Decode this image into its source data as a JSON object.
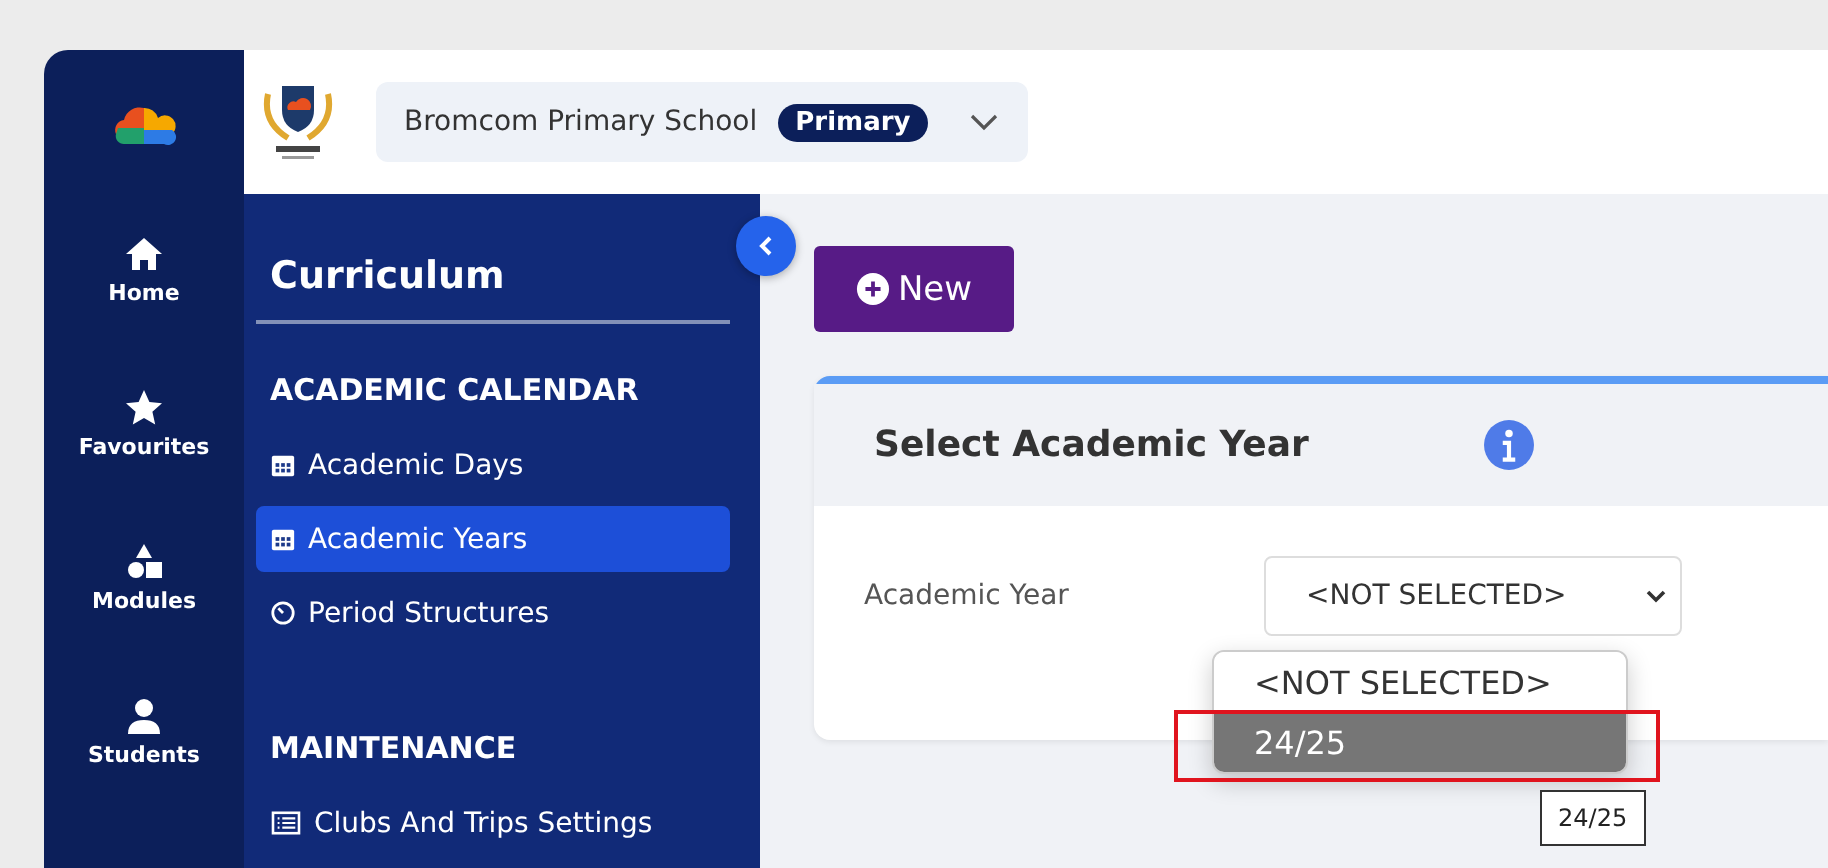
{
  "school_selector": {
    "name": "Bromcom Primary School",
    "badge": "Primary"
  },
  "rail": [
    {
      "kind": "home",
      "label": "Home"
    },
    {
      "kind": "star",
      "label": "Favourites"
    },
    {
      "kind": "shapes",
      "label": "Modules"
    },
    {
      "kind": "person",
      "label": "Students"
    }
  ],
  "side_panel": {
    "title": "Curriculum",
    "sections": [
      {
        "heading": "ACADEMIC CALENDAR",
        "items": [
          {
            "kind": "calendar",
            "label": "Academic Days",
            "selected": false
          },
          {
            "kind": "calendar",
            "label": "Academic Years",
            "selected": true
          },
          {
            "kind": "timer",
            "label": "Period Structures",
            "selected": false
          }
        ]
      },
      {
        "heading": "MAINTENANCE",
        "items": [
          {
            "kind": "list",
            "label": "Clubs And Trips Settings",
            "selected": false
          }
        ]
      }
    ]
  },
  "new_button": "New",
  "card": {
    "title": "Select Academic Year",
    "field_label": "Academic Year",
    "select_value": "<NOT SELECTED>",
    "options": [
      {
        "label": "<NOT SELECTED>",
        "selected": false
      },
      {
        "label": "24/25",
        "selected": true
      }
    ],
    "tooltip": "24/25"
  }
}
